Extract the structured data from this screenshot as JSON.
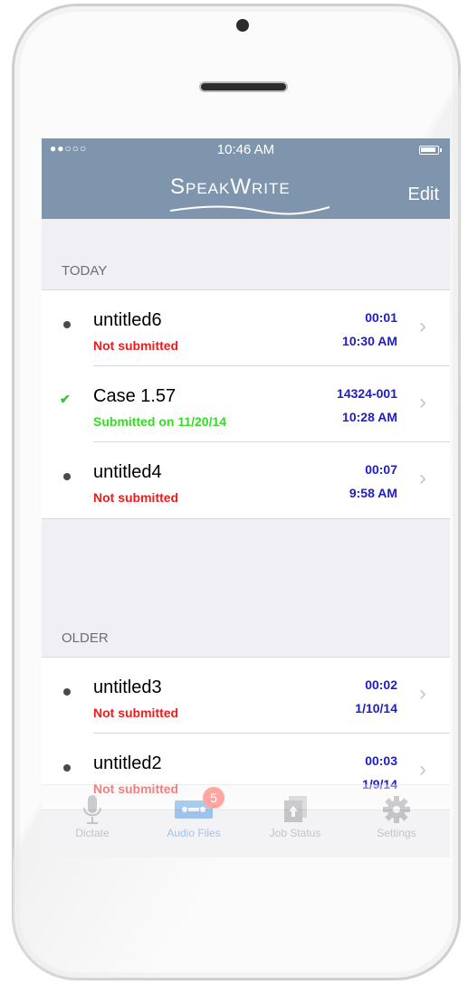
{
  "status_bar": {
    "signal": "●●○○○",
    "time": "10:46 AM"
  },
  "navbar": {
    "logo": "SpeakWrite",
    "edit_label": "Edit"
  },
  "sections": [
    {
      "header": "TODAY",
      "items": [
        {
          "title": "untitled6",
          "status": "Not submitted",
          "status_type": "not-submitted",
          "meta1": "00:01",
          "meta2": "10:30 AM",
          "icon": "dot-icon"
        },
        {
          "title": "Case 1.57",
          "status": "Submitted on 11/20/14",
          "status_type": "submitted",
          "meta1": "14324-001",
          "meta2": "10:28 AM",
          "icon": "check-icon"
        },
        {
          "title": "untitled4",
          "status": "Not submitted",
          "status_type": "not-submitted",
          "meta1": "00:07",
          "meta2": "9:58 AM",
          "icon": "dot-icon"
        }
      ]
    },
    {
      "header": "OLDER",
      "items": [
        {
          "title": "untitled3",
          "status": "Not submitted",
          "status_type": "not-submitted",
          "meta1": "00:02",
          "meta2": "1/10/14",
          "icon": "dot-icon"
        },
        {
          "title": "untitled2",
          "status": "Not submitted",
          "status_type": "not-submitted",
          "meta1": "00:03",
          "meta2": "1/9/14",
          "icon": "dot-icon"
        }
      ]
    }
  ],
  "tabbar": {
    "tabs": [
      {
        "label": "Dictate",
        "icon": "microphone-icon",
        "active": false
      },
      {
        "label": "Audio Files",
        "icon": "cassette-icon",
        "active": true,
        "badge": "5"
      },
      {
        "label": "Job Status",
        "icon": "document-upload-icon",
        "active": false
      },
      {
        "label": "Settings",
        "icon": "gear-icon",
        "active": false
      }
    ]
  },
  "colors": {
    "navbar": "#7f95ad",
    "not_submitted": "#ee1c1c",
    "submitted": "#33dd22",
    "meta": "#1d1dc8",
    "active_tab": "#3b8fe0"
  }
}
